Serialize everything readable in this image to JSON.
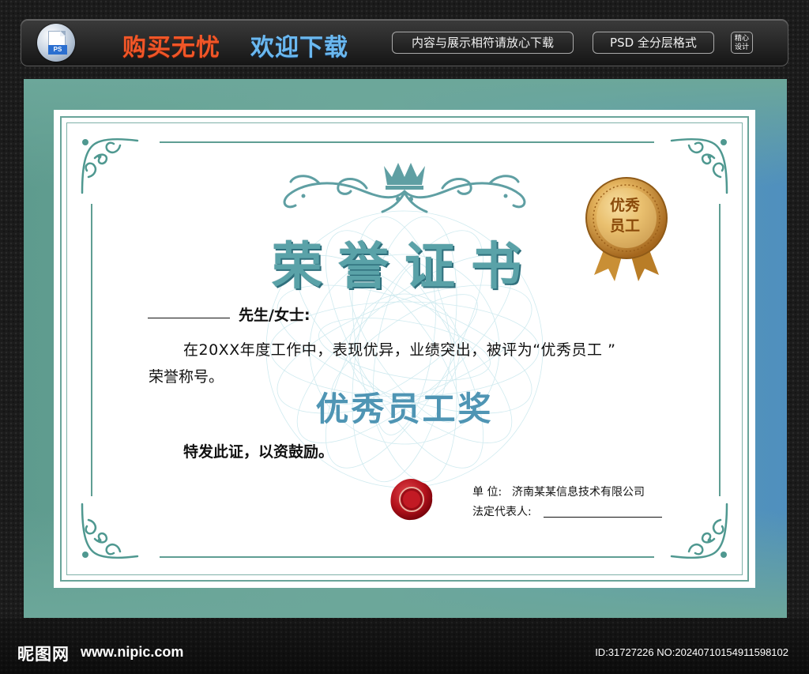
{
  "top_bar": {
    "slogan_red": "购买无忧",
    "slogan_blue": "欢迎下载",
    "ps_badge_label": "PS",
    "note_pill": "内容与展示相符请放心下载",
    "format_pill": "PSD 全分层格式",
    "seal_text_line1": "精心",
    "seal_text_line2": "设计"
  },
  "certificate": {
    "title": "荣誉证书",
    "salutation": "先生/女士:",
    "body_line1": "在20XX年度工作中，表现优异，业绩突出，被评为“优秀员工 ”",
    "body_line2": "荣誉称号。",
    "award_name": "优秀员工奖",
    "issue_text": "特发此证，以资鼓励。",
    "org_label": "单  位:",
    "org_value": "济南某某信息技术有限公司",
    "rep_label": "法定代表人:",
    "medal_text_line1": "优秀",
    "medal_text_line2": "员工",
    "colors": {
      "teal": "#5f9e93",
      "title_teal": "#5aa2a8",
      "award_blue": "#4f95b4",
      "gold": "#d9a447",
      "seal_red": "#b3121c"
    }
  },
  "watermark": {
    "site_name": "昵图网",
    "url": "www.nipic.com",
    "id_text": "ID:31727226 NO:20240710154911598102"
  }
}
